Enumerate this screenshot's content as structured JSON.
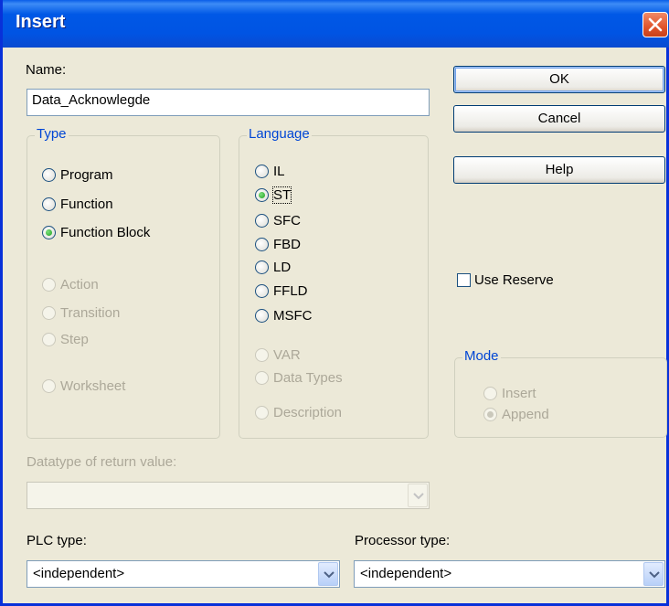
{
  "window": {
    "title": "Insert"
  },
  "name_field": {
    "label": "Name:",
    "value": "Data_Acknowlegde"
  },
  "buttons": {
    "ok": "OK",
    "cancel": "Cancel",
    "help": "Help"
  },
  "type_group": {
    "title": "Type",
    "options": [
      {
        "label": "Program",
        "checked": false,
        "enabled": true
      },
      {
        "label": "Function",
        "checked": false,
        "enabled": true
      },
      {
        "label": "Function Block",
        "checked": true,
        "enabled": true
      },
      {
        "label": "Action",
        "checked": false,
        "enabled": false
      },
      {
        "label": "Transition",
        "checked": false,
        "enabled": false
      },
      {
        "label": "Step",
        "checked": false,
        "enabled": false
      },
      {
        "label": "Worksheet",
        "checked": false,
        "enabled": false
      }
    ]
  },
  "language_group": {
    "title": "Language",
    "options": [
      {
        "label": "IL",
        "checked": false,
        "enabled": true
      },
      {
        "label": "ST",
        "checked": true,
        "enabled": true
      },
      {
        "label": "SFC",
        "checked": false,
        "enabled": true
      },
      {
        "label": "FBD",
        "checked": false,
        "enabled": true
      },
      {
        "label": "LD",
        "checked": false,
        "enabled": true
      },
      {
        "label": "FFLD",
        "checked": false,
        "enabled": true
      },
      {
        "label": "MSFC",
        "checked": false,
        "enabled": true
      },
      {
        "label": "VAR",
        "checked": false,
        "enabled": false
      },
      {
        "label": "Data Types",
        "checked": false,
        "enabled": false
      },
      {
        "label": "Description",
        "checked": false,
        "enabled": false
      }
    ]
  },
  "use_reserve": {
    "label": "Use Reserve",
    "checked": false
  },
  "mode_group": {
    "title": "Mode",
    "options": [
      {
        "label": "Insert",
        "checked": false,
        "enabled": false
      },
      {
        "label": "Append",
        "checked": true,
        "enabled": false
      }
    ]
  },
  "return_type": {
    "label": "Datatype of return value:",
    "value": ""
  },
  "plc_type": {
    "label": "PLC type:",
    "value": "<independent>"
  },
  "processor_type": {
    "label": "Processor type:",
    "value": "<independent>"
  },
  "colors": {
    "title_bar": "#0054e3",
    "group_title": "#0046d5",
    "disabled_text": "#aca899",
    "dialog_bg": "#ece9d8"
  }
}
